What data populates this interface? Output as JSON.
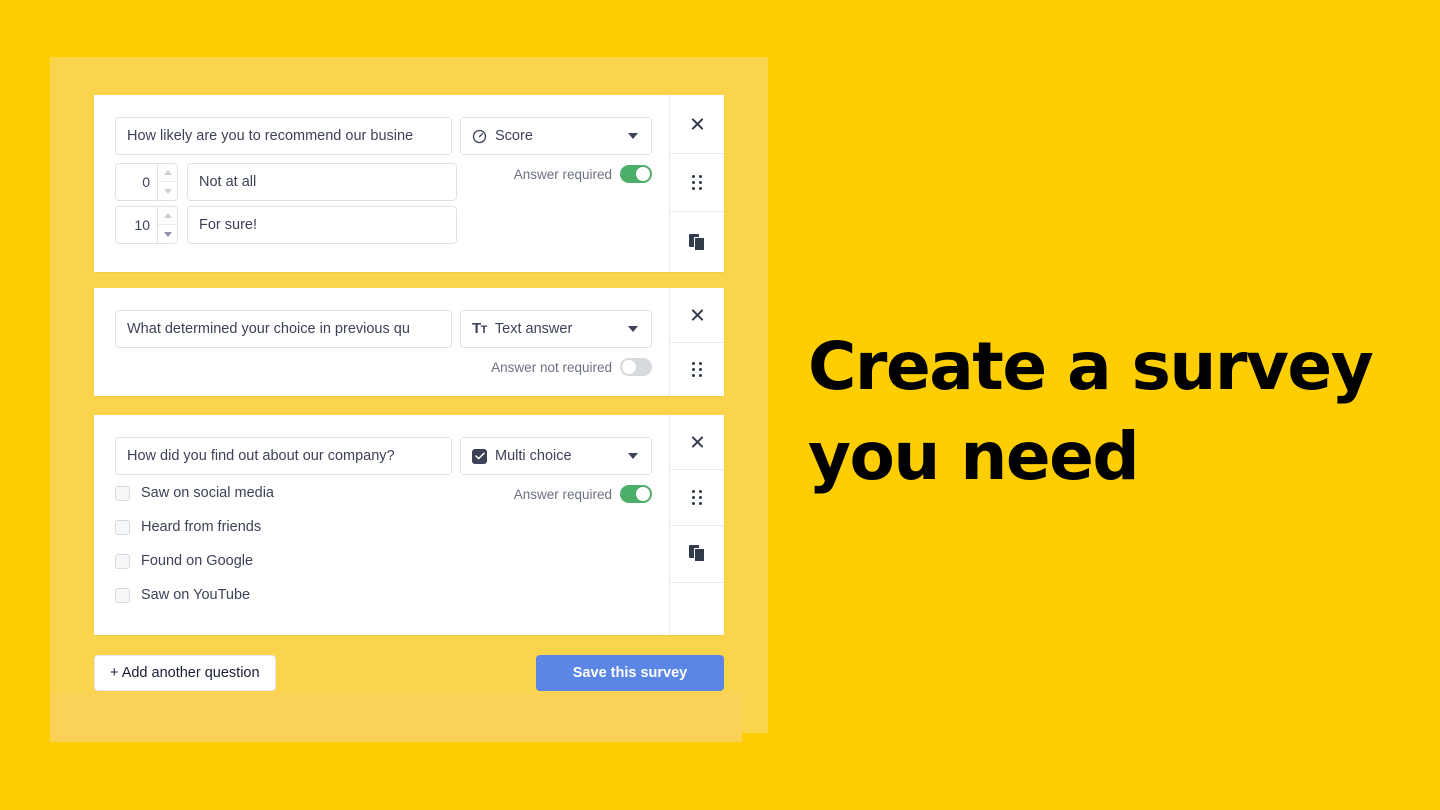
{
  "theme": {
    "page_background": "#FFCE00",
    "panel_background": "#FAD54B",
    "panel_foot_background": "#F9D257",
    "accent_button": "#5B86E5",
    "toggle_on": "#4CAF69",
    "toggle_off": "#d6d9de",
    "text": "#3c4257"
  },
  "headline": {
    "line1": "Create a survey",
    "line2": "you need"
  },
  "actions": {
    "close_icon": "close-icon",
    "drag_icon": "drag-handle-icon",
    "duplicate_icon": "duplicate-icon"
  },
  "questions": [
    {
      "title": "How likely are you to recommend our busine",
      "type_label": "Score",
      "type_icon": "gauge-icon",
      "required_label": "Answer required",
      "required": true,
      "scale": [
        {
          "value": "0",
          "label": "Not at all"
        },
        {
          "value": "10",
          "label": "For sure!"
        }
      ],
      "options": []
    },
    {
      "title": "What determined your choice in previous qu",
      "type_label": "Text answer",
      "type_icon": "text-format-icon",
      "required_label": "Answer not required",
      "required": false,
      "scale": [],
      "options": []
    },
    {
      "title": "How did you find out about our company?",
      "type_label": "Multi choice",
      "type_icon": "checkbox-checked-icon",
      "required_label": "Answer required",
      "required": true,
      "scale": [],
      "options": [
        "Saw on social media",
        "Heard from friends",
        "Found on Google",
        "Saw on YouTube"
      ]
    }
  ],
  "footer": {
    "add_question_label": "+ Add another question",
    "save_label": "Save this survey"
  }
}
